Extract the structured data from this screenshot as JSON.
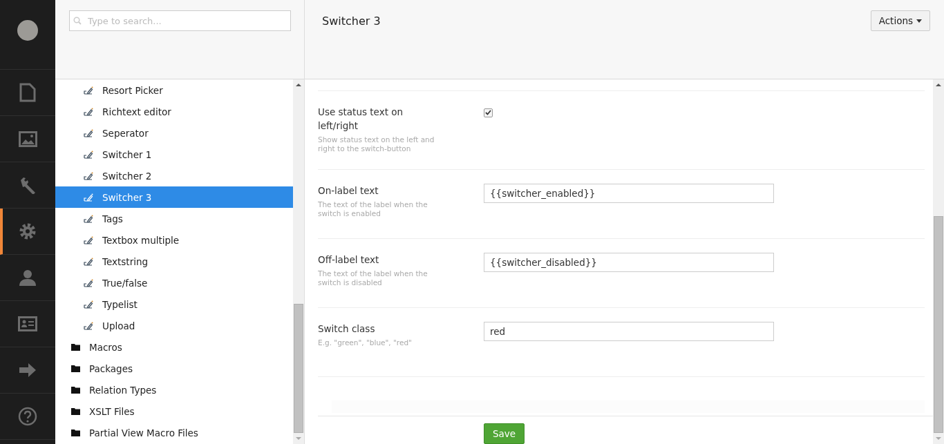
{
  "nav": [
    {
      "kind": "document",
      "selected": false
    },
    {
      "kind": "image",
      "selected": false
    },
    {
      "kind": "wrench",
      "selected": false
    },
    {
      "kind": "gear",
      "selected": true
    },
    {
      "kind": "person",
      "selected": false
    },
    {
      "kind": "card",
      "selected": false
    },
    {
      "kind": "arrow",
      "selected": false
    },
    {
      "kind": "help",
      "selected": false
    }
  ],
  "search": {
    "placeholder": "Type to search..."
  },
  "tree": [
    {
      "kind": "datatype",
      "label": "Resort Picker",
      "selected": false
    },
    {
      "kind": "datatype",
      "label": "Richtext editor",
      "selected": false
    },
    {
      "kind": "datatype",
      "label": "Seperator",
      "selected": false
    },
    {
      "kind": "datatype",
      "label": "Switcher 1",
      "selected": false
    },
    {
      "kind": "datatype",
      "label": "Switcher 2",
      "selected": false
    },
    {
      "kind": "datatype",
      "label": "Switcher 3",
      "selected": true
    },
    {
      "kind": "datatype",
      "label": "Tags",
      "selected": false
    },
    {
      "kind": "datatype",
      "label": "Textbox multiple",
      "selected": false
    },
    {
      "kind": "datatype",
      "label": "Textstring",
      "selected": false
    },
    {
      "kind": "datatype",
      "label": "True/false",
      "selected": false
    },
    {
      "kind": "datatype",
      "label": "Typelist",
      "selected": false
    },
    {
      "kind": "datatype",
      "label": "Upload",
      "selected": false
    },
    {
      "kind": "folder",
      "label": "Macros",
      "selected": false
    },
    {
      "kind": "folder",
      "label": "Packages",
      "selected": false
    },
    {
      "kind": "folder",
      "label": "Relation Types",
      "selected": false
    },
    {
      "kind": "folder",
      "label": "XSLT Files",
      "selected": false
    },
    {
      "kind": "folder",
      "label": "Partial View Macro Files",
      "selected": false
    }
  ],
  "editor": {
    "title": "Switcher 3",
    "actions_button": "Actions",
    "properties": [
      {
        "kind": "checkbox",
        "label": "Use status text on left/right",
        "description": "Show status text on the left and right to the switch-button",
        "checked": true
      },
      {
        "kind": "text",
        "label": "On-label text",
        "description": "The text of the label when the switch is enabled",
        "value": "{{switcher_enabled}}"
      },
      {
        "kind": "text",
        "label": "Off-label text",
        "description": "The text of the label when the switch is disabled",
        "value": "{{switcher_disabled}}"
      },
      {
        "kind": "text",
        "label": "Switch class",
        "description": "E.g. \"green\", \"blue\", \"red\"",
        "value": "red"
      }
    ],
    "save_button": "Save"
  }
}
